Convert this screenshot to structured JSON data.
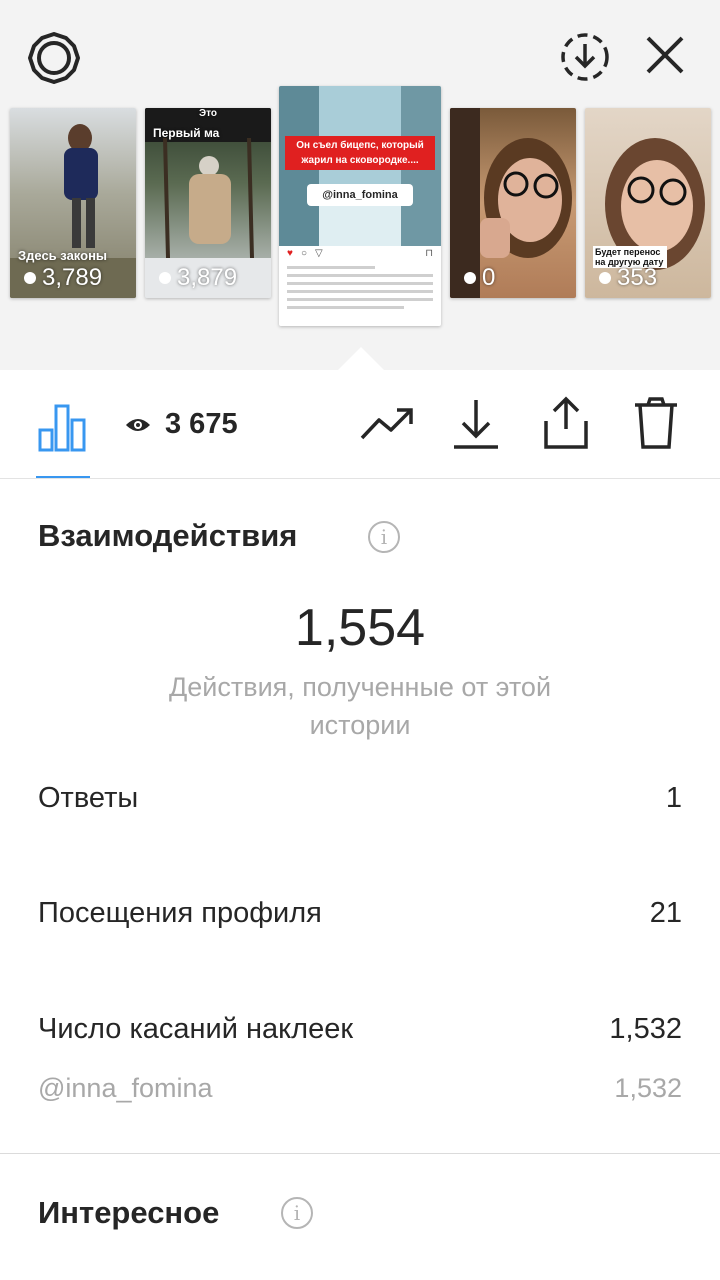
{
  "header": {
    "settings_icon": "gear-icon",
    "download_icon": "download-circle-icon",
    "close_icon": "close-icon"
  },
  "stories": [
    {
      "caption": "Здесь законы",
      "views": "3,789"
    },
    {
      "caption_top": "Это",
      "caption": "Первый ма",
      "views": "3,879"
    },
    {
      "headline": "Он съел бицепс, который жарил на сковородке....",
      "mention": "@inna_fomina",
      "selected": true
    },
    {
      "caption": "",
      "views": "0"
    },
    {
      "caption": "Будет перенос на другую дату",
      "views": "353"
    }
  ],
  "toolbar": {
    "insights_icon": "bar-chart-icon",
    "views_icon": "eye-icon",
    "views_value": "3 675",
    "promote_icon": "trending-up-icon",
    "save_icon": "download-icon",
    "share_icon": "share-icon",
    "delete_icon": "trash-icon"
  },
  "interactions": {
    "title": "Взаимодействия",
    "total": "1,554",
    "total_caption": "Действия, полученные от этой истории",
    "rows": [
      {
        "label": "Ответы",
        "value": "1"
      },
      {
        "label": "Посещения профиля",
        "value": "21"
      },
      {
        "label": "Число касаний наклеек",
        "value": "1,532"
      }
    ],
    "sub_row": {
      "label": "@inna_fomina",
      "value": "1,532"
    }
  },
  "discovery": {
    "title": "Интересное"
  }
}
